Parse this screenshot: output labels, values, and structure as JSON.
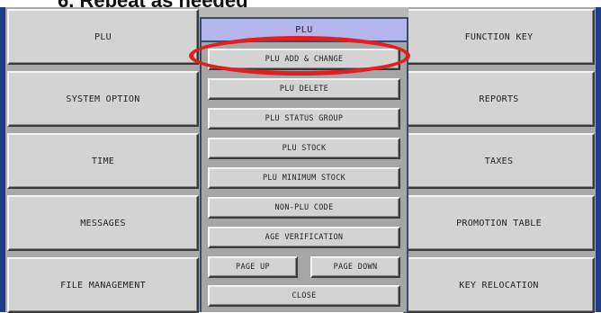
{
  "heading": "6. Repeat as needed",
  "main_menu": {
    "left": [
      "PLU",
      "SYSTEM OPTION",
      "TIME",
      "MESSAGES",
      "FILE MANAGEMENT"
    ],
    "right": [
      "FUNCTION KEY",
      "REPORTS",
      "TAXES",
      "PROMOTION TABLE",
      "KEY RELOCATION"
    ]
  },
  "dialog": {
    "title": "PLU",
    "items": [
      "PLU ADD & CHANGE",
      "PLU DELETE",
      "PLU STATUS GROUP",
      "PLU STOCK",
      "PLU MINIMUM STOCK",
      "NON-PLU CODE",
      "AGE VERIFICATION"
    ],
    "page_up": "PAGE UP",
    "page_down": "PAGE DOWN",
    "close": "CLOSE"
  },
  "highlight": {
    "target": "PLU ADD & CHANGE",
    "color": "#e21e1e"
  }
}
